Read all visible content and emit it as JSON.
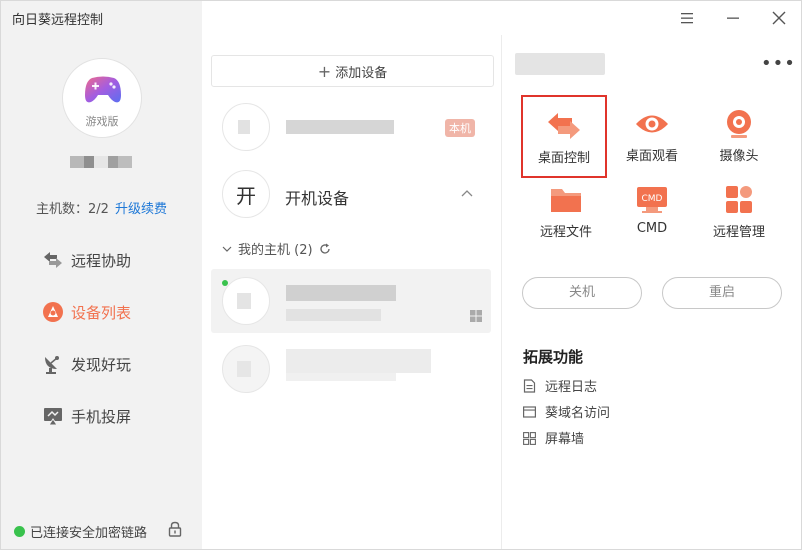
{
  "app": {
    "title": "向日葵远程控制"
  },
  "sidebar": {
    "edition_label": "游戏版",
    "host_count": "主机数：2/2",
    "upgrade_link": "升级续费",
    "nav": [
      {
        "label": "远程协助",
        "icon": "remote-assist-icon",
        "active": false
      },
      {
        "label": "设备列表",
        "icon": "device-list-icon",
        "active": true
      },
      {
        "label": "发现好玩",
        "icon": "satellite-dish-icon",
        "active": false
      },
      {
        "label": "手机投屏",
        "icon": "screen-cast-icon",
        "active": false
      }
    ],
    "connection_status": "已连接安全加密链路"
  },
  "middle": {
    "add_device": "添加设备",
    "local_badge": "本机",
    "boot_icon_char": "开",
    "boot_devices": "开机设备",
    "group_label": "我的主机 (2)"
  },
  "right": {
    "functions": [
      {
        "label": "桌面控制",
        "icon": "desktop-control-icon"
      },
      {
        "label": "桌面观看",
        "icon": "eye-icon"
      },
      {
        "label": "摄像头",
        "icon": "camera-icon"
      },
      {
        "label": "远程文件",
        "icon": "folder-icon"
      },
      {
        "label": "CMD",
        "icon": "cmd-icon",
        "icon_text": "CMD"
      },
      {
        "label": "远程管理",
        "icon": "grid-manage-icon"
      }
    ],
    "shutdown": "关机",
    "restart": "重启",
    "extensions_title": "拓展功能",
    "extensions": [
      {
        "label": "远程日志",
        "icon": "log-icon"
      },
      {
        "label": "葵域名访问",
        "icon": "domain-icon"
      },
      {
        "label": "屏幕墙",
        "icon": "screen-wall-icon"
      }
    ]
  },
  "colors": {
    "accent": "#f2724f",
    "selection_border": "#e0342b",
    "online": "#39c24d",
    "link": "#1e78d7"
  }
}
